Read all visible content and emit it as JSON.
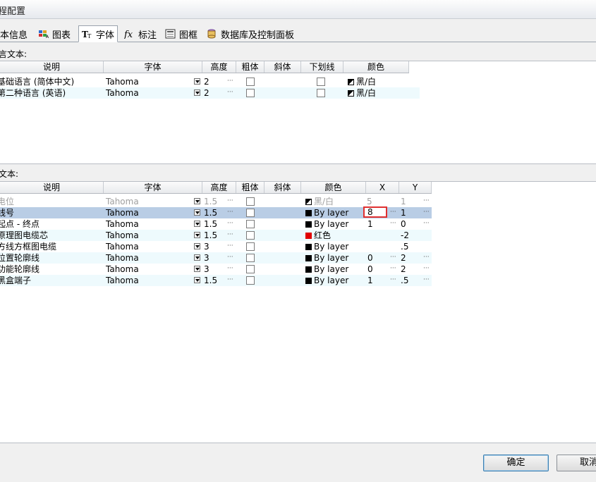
{
  "window": {
    "title": "程配置"
  },
  "tabs": [
    {
      "label": "本信息",
      "icon": "info-icon"
    },
    {
      "label": "图表",
      "icon": "chart-icon"
    },
    {
      "label": "字体",
      "icon": "font-icon"
    },
    {
      "label": "标注",
      "icon": "function-icon"
    },
    {
      "label": "图框",
      "icon": "frame-icon"
    },
    {
      "label": "数据库及控制面板",
      "icon": "database-icon"
    }
  ],
  "lang_section": {
    "label": "言文本:",
    "headers": [
      "说明",
      "字体",
      "高度",
      "粗体",
      "斜体",
      "下划线",
      "颜色"
    ],
    "rows": [
      {
        "desc": "基础语言 (简体中文)",
        "font": "Tahoma",
        "height": "2",
        "color": "黑/白"
      },
      {
        "desc": "第二种语言 (英语)",
        "font": "Tahoma",
        "height": "2",
        "color": "黑/白"
      }
    ]
  },
  "text_section": {
    "label": "文本:",
    "headers": [
      "说明",
      "字体",
      "高度",
      "粗体",
      "斜体",
      "颜色",
      "X",
      "Y"
    ],
    "rows": [
      {
        "desc": "电位",
        "font": "Tahoma",
        "height": "1.5",
        "color": "黑/白",
        "x": "5",
        "y": "1"
      },
      {
        "desc": "线号",
        "font": "Tahoma",
        "height": "1.5",
        "color": "By layer",
        "x": "8",
        "y": "1"
      },
      {
        "desc": "起点 - 终点",
        "font": "Tahoma",
        "height": "1.5",
        "color": "By layer",
        "x": "1",
        "y": "0"
      },
      {
        "desc": "原理图电缆芯",
        "font": "Tahoma",
        "height": "1.5",
        "color": "红色",
        "x": "",
        "y": "-2"
      },
      {
        "desc": "方线方框图电缆",
        "font": "Tahoma",
        "height": "3",
        "color": "By layer",
        "x": "",
        "y": ".5"
      },
      {
        "desc": "位置轮廓线",
        "font": "Tahoma",
        "height": "3",
        "color": "By layer",
        "x": "0",
        "y": "2"
      },
      {
        "desc": "功能轮廓线",
        "font": "Tahoma",
        "height": "3",
        "color": "By layer",
        "x": "0",
        "y": "2"
      },
      {
        "desc": "黑盒端子",
        "font": "Tahoma",
        "height": "1.5",
        "color": "By layer",
        "x": "1",
        "y": ".5"
      }
    ]
  },
  "footer": {
    "ok_label": "确定",
    "cancel_label": "取消"
  },
  "ellipsis": "···",
  "colors": {
    "selected_row": "#b9cde5",
    "alt_row": "#eefafd",
    "edit_border": "#e03030"
  }
}
